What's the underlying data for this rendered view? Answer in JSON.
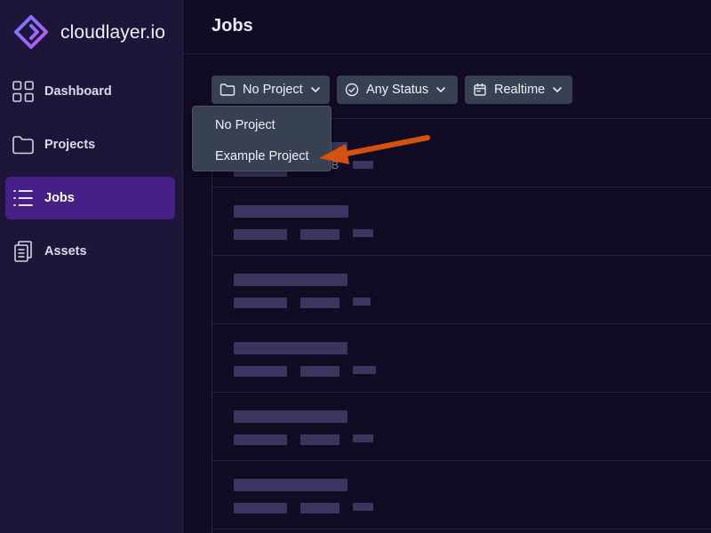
{
  "brand": {
    "name": "cloudlayer.io"
  },
  "sidebar": {
    "items": [
      {
        "label": "Dashboard",
        "icon": "grid-icon"
      },
      {
        "label": "Projects",
        "icon": "folder-icon"
      },
      {
        "label": "Jobs",
        "icon": "list-icon",
        "active": true
      },
      {
        "label": "Assets",
        "icon": "documents-icon"
      }
    ]
  },
  "header": {
    "title": "Jobs"
  },
  "filters": {
    "project": "No Project",
    "status": "Any Status",
    "mode": "Realtime"
  },
  "dropdown": {
    "items": [
      "No Project",
      "Example Project"
    ]
  },
  "partial_text": {
    "row1_suffix": "B"
  },
  "colors": {
    "accent": "#452086",
    "annotation_arrow": "#d4520f"
  }
}
